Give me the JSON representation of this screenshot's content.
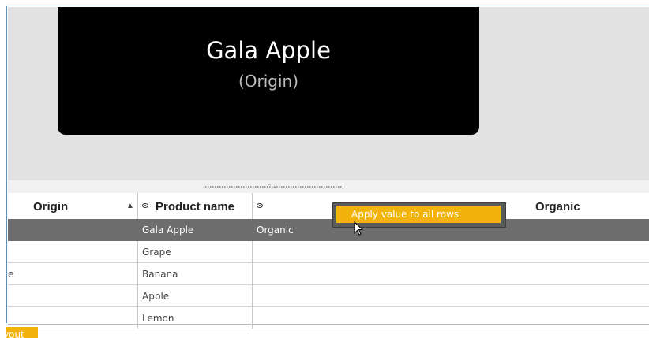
{
  "preview": {
    "title": "Gala Apple",
    "subtitle": "(Origin)"
  },
  "grid": {
    "columns": [
      {
        "label": "Origin",
        "sort": "ascending"
      },
      {
        "label": "Product name",
        "icon": "eye-icon"
      },
      {
        "label": "Organic",
        "icon": "eye-icon"
      }
    ],
    "rows": [
      {
        "origin": "",
        "product": "Gala Apple",
        "organic": "Organic",
        "selected": true
      },
      {
        "origin": "",
        "product": "Grape",
        "organic": ""
      },
      {
        "origin": "e",
        "product": "Banana",
        "organic": ""
      },
      {
        "origin": "",
        "product": "Apple",
        "organic": ""
      },
      {
        "origin": "",
        "product": "Lemon",
        "organic": ""
      }
    ]
  },
  "context_menu": {
    "item": "Apply value to all rows"
  },
  "footer": {
    "layout_button": "yout"
  },
  "colors": {
    "accent": "#f2b40b",
    "selected_row": "#6d6d6d",
    "preview_bg": "#e2e2e2",
    "card_bg": "#000000"
  }
}
